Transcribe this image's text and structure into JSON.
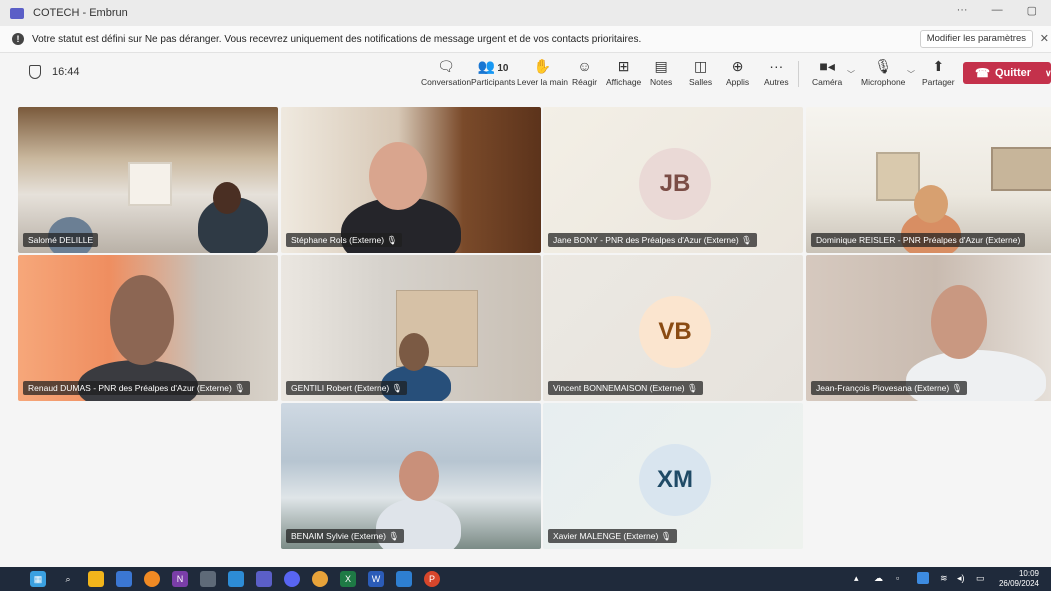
{
  "window": {
    "title": "COTECH - Embrun",
    "controls": [
      "···",
      "—",
      "▢"
    ]
  },
  "notification": {
    "text": "Votre statut est défini sur Ne pas déranger. Vous recevrez uniquement des notifications de message urgent et de vos contacts prioritaires.",
    "button_label": "Modifier les paramètres",
    "close_label": "✕"
  },
  "meeting": {
    "time": "16:44"
  },
  "toolbar": {
    "conversation": "Conversation",
    "participants": "Participants",
    "participants_count": "10",
    "raise_hand": "Lever la main",
    "react": "Réagir",
    "view": "Affichage",
    "notes": "Notes",
    "rooms": "Salles",
    "apps": "Applis",
    "more": "Autres",
    "camera": "Caméra",
    "microphone": "Microphone",
    "share": "Partager",
    "leave": "Quitter"
  },
  "participants": [
    {
      "name": "Salomé DELILLE"
    },
    {
      "name": "Stéphane Rols (Externe)"
    },
    {
      "name": "Jane BONY - PNR des Préalpes d'Azur (Externe)",
      "initials": "JB"
    },
    {
      "name": "Dominique REISLER - PNR Préalpes d'Azur (Externe)"
    },
    {
      "name": "Renaud DUMAS - PNR des Préalpes d'Azur (Externe)"
    },
    {
      "name": "GENTILI Robert (Externe)"
    },
    {
      "name": "Vincent BONNEMAISON (Externe)",
      "initials": "VB"
    },
    {
      "name": "Jean-François Piovesana (Externe)"
    },
    {
      "name": "BENAIM Sylvie (Externe)"
    },
    {
      "name": "Xavier MALENGE (Externe)",
      "initials": "XM"
    }
  ],
  "colors": {
    "leave_button": "#c4314b",
    "brand": "#5b5fc7"
  },
  "taskbar": {
    "time": "10:09",
    "date": "26/09/2024"
  }
}
